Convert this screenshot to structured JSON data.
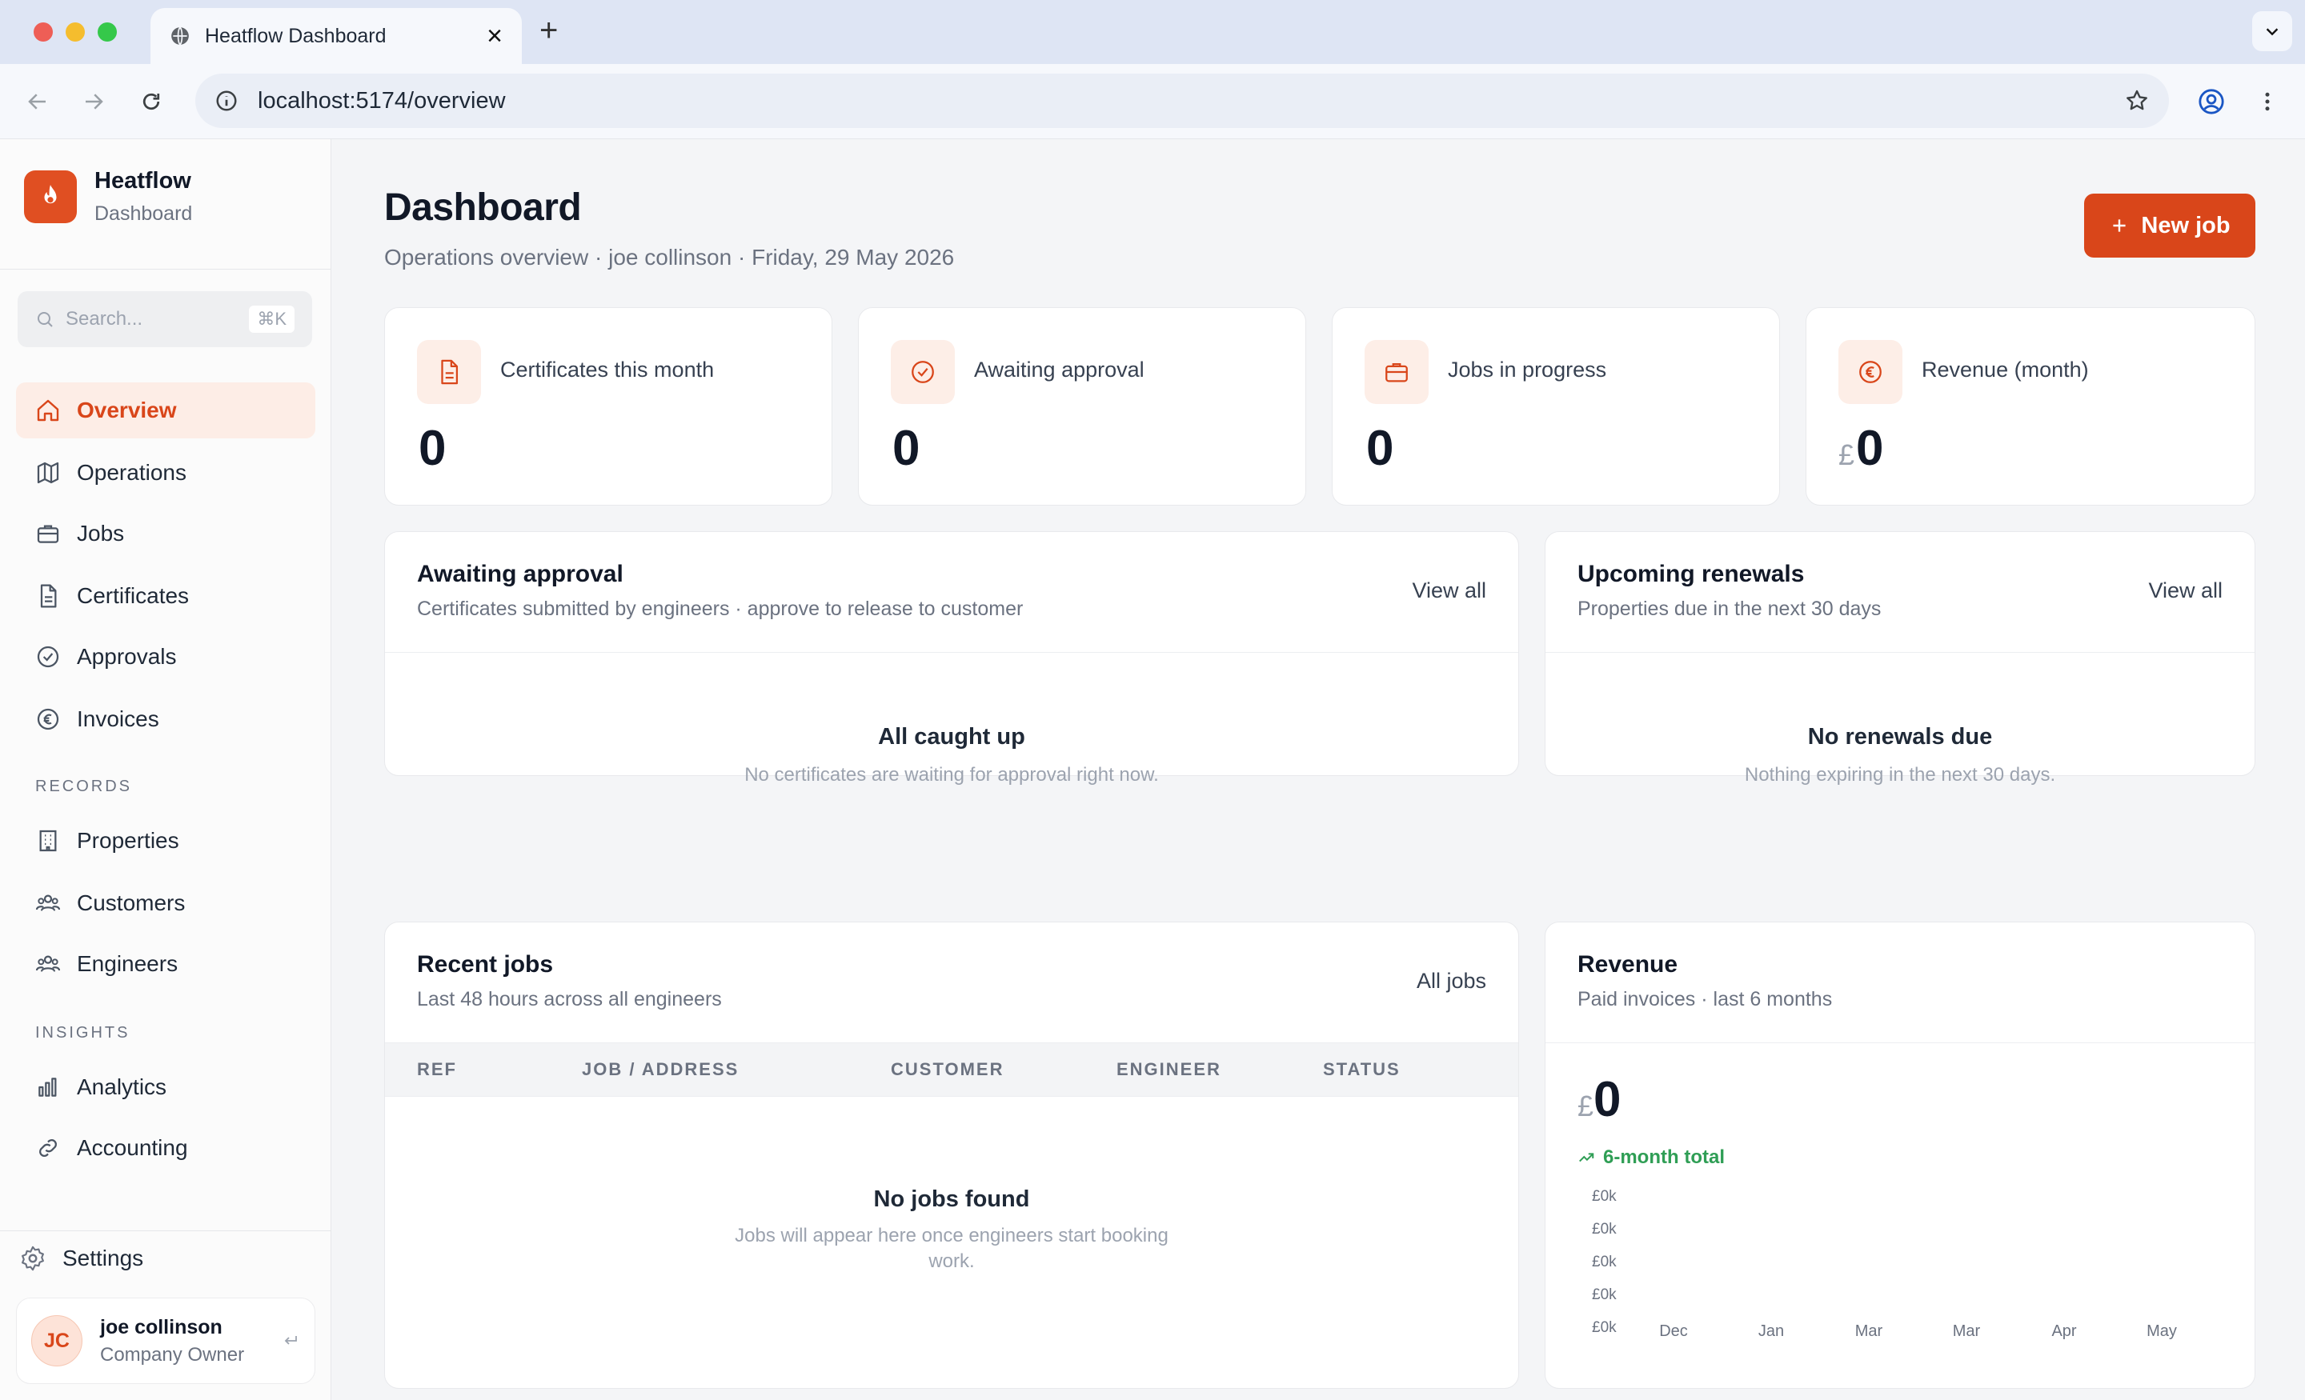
{
  "browser": {
    "tab_title": "Heatflow Dashboard",
    "url": "localhost:5174/overview"
  },
  "brand": {
    "name": "Heatflow",
    "subtitle": "Dashboard",
    "accent": "#e04f22"
  },
  "search": {
    "placeholder": "Search...",
    "shortcut": "⌘K"
  },
  "nav": {
    "main": [
      {
        "label": "Overview",
        "icon": "home-icon",
        "active": true
      },
      {
        "label": "Operations",
        "icon": "map-icon"
      },
      {
        "label": "Jobs",
        "icon": "briefcase-icon"
      },
      {
        "label": "Certificates",
        "icon": "file-icon"
      },
      {
        "label": "Approvals",
        "icon": "badge-check-icon"
      },
      {
        "label": "Invoices",
        "icon": "euro-icon"
      }
    ],
    "records_label": "RECORDS",
    "records": [
      {
        "label": "Properties",
        "icon": "building-icon"
      },
      {
        "label": "Customers",
        "icon": "users-icon"
      },
      {
        "label": "Engineers",
        "icon": "users-icon"
      }
    ],
    "insights_label": "INSIGHTS",
    "insights": [
      {
        "label": "Analytics",
        "icon": "bar-chart-icon"
      },
      {
        "label": "Accounting",
        "icon": "link-icon"
      }
    ],
    "settings_label": "Settings"
  },
  "user": {
    "initials": "JC",
    "name": "joe collinson",
    "role": "Company Owner"
  },
  "header": {
    "title": "Dashboard",
    "subtitle": "Operations overview · joe collinson · Friday, 29 May 2026",
    "new_job": "New job"
  },
  "stats": [
    {
      "label": "Certificates this month",
      "value": "0",
      "currency": "",
      "icon": "file-icon"
    },
    {
      "label": "Awaiting approval",
      "value": "0",
      "currency": "",
      "icon": "badge-check-icon"
    },
    {
      "label": "Jobs in progress",
      "value": "0",
      "currency": "",
      "icon": "briefcase-icon"
    },
    {
      "label": "Revenue (month)",
      "value": "0",
      "currency": "£",
      "icon": "euro-icon"
    }
  ],
  "awaiting": {
    "title": "Awaiting approval",
    "subtitle": "Certificates submitted by engineers · approve to release to customer",
    "link": "View all",
    "empty_title": "All caught up",
    "empty_sub": "No certificates are waiting for approval right now."
  },
  "renewals": {
    "title": "Upcoming renewals",
    "subtitle": "Properties due in the next 30 days",
    "link": "View all",
    "empty_title": "No renewals due",
    "empty_sub": "Nothing expiring in the next 30 days."
  },
  "recent_jobs": {
    "title": "Recent jobs",
    "subtitle": "Last 48 hours across all engineers",
    "link": "All jobs",
    "columns": [
      "REF",
      "JOB / ADDRESS",
      "CUSTOMER",
      "ENGINEER",
      "STATUS"
    ],
    "empty_title": "No jobs found",
    "empty_sub": "Jobs will appear here once engineers start booking work."
  },
  "revenue": {
    "title": "Revenue",
    "subtitle": "Paid invoices · last 6 months",
    "currency": "£",
    "total": "0",
    "trend_label": "6-month total"
  },
  "chart_data": {
    "type": "bar",
    "categories": [
      "Dec",
      "Jan",
      "Mar",
      "Mar",
      "Apr",
      "May"
    ],
    "values": [
      0,
      0,
      0,
      0,
      0,
      0
    ],
    "yticks": [
      "£0k",
      "£0k",
      "£0k",
      "£0k",
      "£0k"
    ],
    "title": "",
    "xlabel": "",
    "ylabel": ""
  }
}
